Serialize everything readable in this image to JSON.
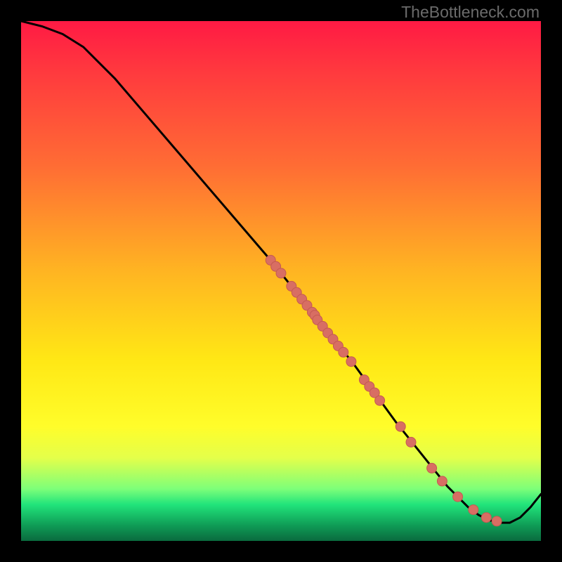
{
  "watermark": "TheBottleneck.com",
  "colors": {
    "background": "#000000",
    "curve": "#000000",
    "dot": "#d86e63",
    "dot_stroke": "#c45a52"
  },
  "chart_data": {
    "type": "line",
    "title": "",
    "xlabel": "",
    "ylabel": "",
    "xlim": [
      0,
      100
    ],
    "ylim": [
      0,
      100
    ],
    "series": [
      {
        "name": "curve",
        "x": [
          0,
          4,
          8,
          12,
          18,
          24,
          30,
          36,
          42,
          48,
          52,
          56,
          60,
          64,
          68,
          72,
          76,
          80,
          82,
          84,
          86,
          88,
          90,
          92,
          94,
          96,
          98,
          100
        ],
        "y": [
          100,
          99,
          97.5,
          95,
          89,
          82,
          75,
          68,
          61,
          54,
          49,
          44.5,
          39,
          34,
          28.5,
          23,
          18,
          13,
          10.5,
          8.5,
          6.5,
          5,
          4,
          3.5,
          3.5,
          4.5,
          6.5,
          9
        ]
      }
    ],
    "scatter": [
      {
        "x": 48,
        "y": 54
      },
      {
        "x": 49,
        "y": 52.8
      },
      {
        "x": 50,
        "y": 51.5
      },
      {
        "x": 52,
        "y": 49
      },
      {
        "x": 53,
        "y": 47.8
      },
      {
        "x": 54,
        "y": 46.5
      },
      {
        "x": 55,
        "y": 45.3
      },
      {
        "x": 56,
        "y": 44
      },
      {
        "x": 56.5,
        "y": 43.4
      },
      {
        "x": 57,
        "y": 42.5
      },
      {
        "x": 58,
        "y": 41.3
      },
      {
        "x": 59,
        "y": 40
      },
      {
        "x": 60,
        "y": 38.8
      },
      {
        "x": 61,
        "y": 37.5
      },
      {
        "x": 62,
        "y": 36.3
      },
      {
        "x": 63.5,
        "y": 34.5
      },
      {
        "x": 66,
        "y": 31
      },
      {
        "x": 67,
        "y": 29.7
      },
      {
        "x": 68,
        "y": 28.5
      },
      {
        "x": 69,
        "y": 27
      },
      {
        "x": 73,
        "y": 22
      },
      {
        "x": 75,
        "y": 19
      },
      {
        "x": 79,
        "y": 14
      },
      {
        "x": 81,
        "y": 11.5
      },
      {
        "x": 84,
        "y": 8.5
      },
      {
        "x": 87,
        "y": 6
      },
      {
        "x": 89.5,
        "y": 4.5
      },
      {
        "x": 91.5,
        "y": 3.8
      }
    ]
  }
}
